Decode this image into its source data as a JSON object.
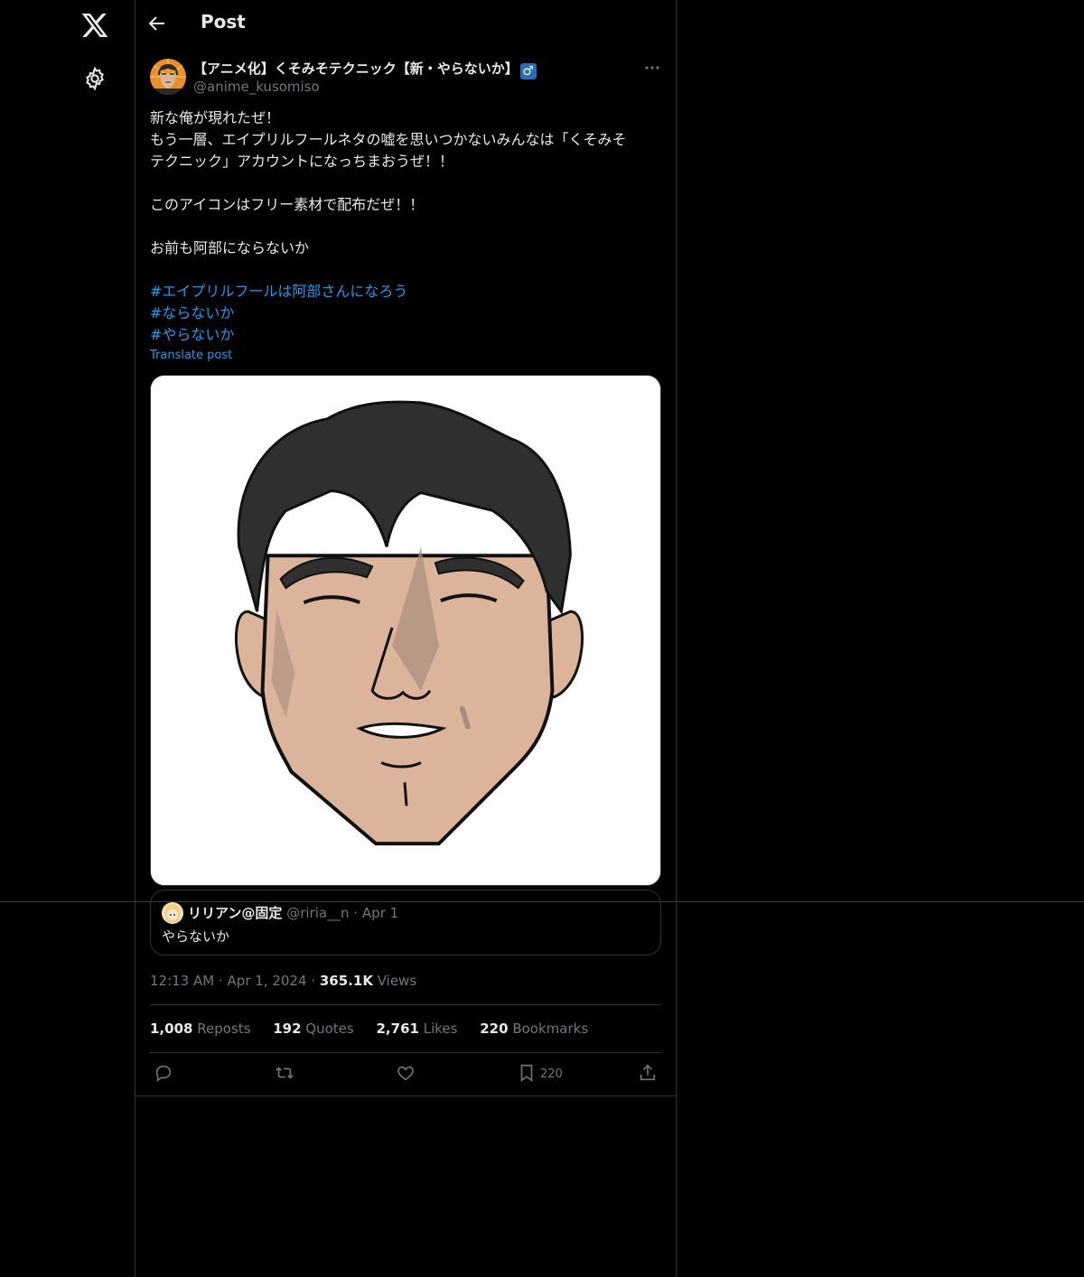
{
  "header": {
    "title": "Post"
  },
  "author": {
    "name": "【アニメ化】くそみそテクニック【新・やらないか】",
    "badge": "♂",
    "handle": "@anime_kusomiso"
  },
  "post": {
    "lines": [
      "新な俺が現れたぜ！",
      "もう一層、エイプリルフールネタの嘘を思いつかないみんなは「くそみそ",
      "テクニック」アカウントになっちまおうぜ！！",
      "",
      "このアイコンはフリー素材で配布だぜ！！",
      "",
      "お前も阿部にならないか",
      ""
    ],
    "hashtags": [
      "#エイプリルフールは阿部さんになろう",
      "#ならないか",
      "#やらないか"
    ],
    "translate_label": "Translate post"
  },
  "quote": {
    "name": "リリアン@固定",
    "handle": "@riria__n",
    "separator": "·",
    "date": "Apr 1",
    "text": "やらないか"
  },
  "meta": {
    "time": "12:13 AM",
    "separator": "·",
    "date": "Apr 1, 2024",
    "views_count": "365.1K",
    "views_label": "Views"
  },
  "stats": {
    "reposts_count": "1,008",
    "reposts_label": "Reposts",
    "quotes_count": "192",
    "quotes_label": "Quotes",
    "likes_count": "2,761",
    "likes_label": "Likes",
    "bookmarks_count": "220",
    "bookmarks_label": "Bookmarks"
  },
  "actions": {
    "bookmark_count": "220"
  },
  "colors": {
    "background": "#000000",
    "text": "#e7e9ea",
    "muted": "#71767b",
    "link": "#1d9bf0",
    "border": "#2f3336"
  }
}
